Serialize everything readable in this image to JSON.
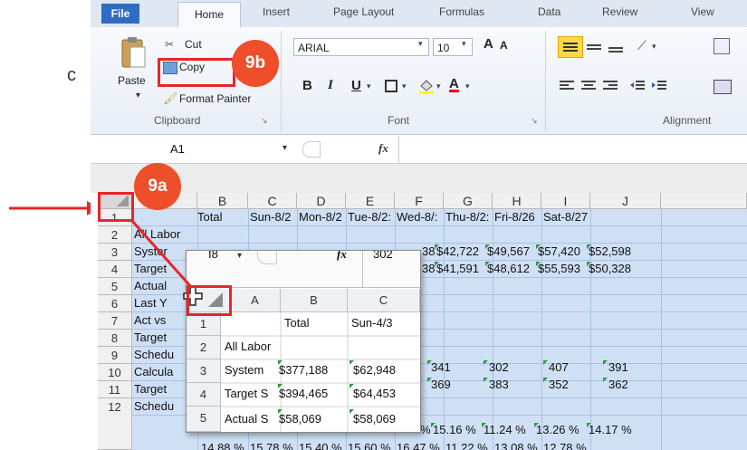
{
  "ribbon": {
    "tabs": [
      "File",
      "Home",
      "Insert",
      "Page Layout",
      "Formulas",
      "Data",
      "Review",
      "View"
    ],
    "clipboard": {
      "cut": "Cut",
      "copy": "Copy",
      "paste": "Paste",
      "format_painter": "Format Painter",
      "label": "Clipboard"
    },
    "font": {
      "name": "ARIAL",
      "size": "10",
      "bold": "B",
      "italic": "I",
      "underline": "U",
      "grow": "A",
      "shrink": "A",
      "color_letter": "A",
      "label": "Font"
    },
    "alignment": {
      "label": "Alignment"
    }
  },
  "formula_bar": {
    "name_box": "A1",
    "fx": "fx"
  },
  "annotations": {
    "badge_9a": "9a",
    "badge_9b": "9b"
  },
  "sheet": {
    "columns": [
      "B",
      "C",
      "D",
      "E",
      "F",
      "G",
      "H",
      "I",
      "J"
    ],
    "rows": [
      "1",
      "2",
      "3",
      "4",
      "5",
      "6",
      "7",
      "8",
      "9",
      "10",
      "11",
      "12"
    ],
    "row1": [
      "Total",
      "Sun-8/2",
      "Mon-8/2",
      "Tue-8/2:",
      "Wed-8/:",
      "Thu-8/2:",
      "Fri-8/26",
      "Sat-8/27"
    ],
    "a_labels": [
      "All Labor",
      "Syster",
      "Target",
      "Actual",
      "Last Y",
      "Act vs",
      "Target",
      "Schedu",
      "Calcula",
      "Target",
      "Schedu"
    ],
    "r3": [
      "38",
      "$42,722",
      "$49,567",
      "$57,420",
      "$52,598"
    ],
    "r4": [
      "38",
      "$41,591",
      "$48,612",
      "$55,593",
      "$50,328"
    ],
    "r8": [
      "341",
      "302",
      "407",
      "391"
    ],
    "r9": [
      "369",
      "383",
      "352",
      "362"
    ],
    "r11": [
      "%",
      "15.16 %",
      "11.24 %",
      "13.26 %",
      "14.17 %"
    ],
    "r12": [
      "14.88 %",
      "15.78 %",
      "15.40 %",
      "15.60 %",
      "16.47 %",
      "11.22 %",
      "13.08 %",
      "12.78 %"
    ]
  },
  "inset": {
    "name_box": "I8",
    "fx": "fx",
    "formula_value": "302",
    "columns": [
      "A",
      "B",
      "C"
    ],
    "rows": [
      "1",
      "2",
      "3",
      "4",
      "5"
    ],
    "r1": [
      "",
      "Total",
      "Sun-4/3"
    ],
    "r2": [
      "All Labor",
      "",
      ""
    ],
    "r3": [
      "System",
      "$377,188",
      "$62,948"
    ],
    "r4": [
      "Target S",
      "$394,465",
      "$64,453"
    ],
    "r5": [
      "Actual S",
      "$58,069",
      "$58,069"
    ]
  }
}
